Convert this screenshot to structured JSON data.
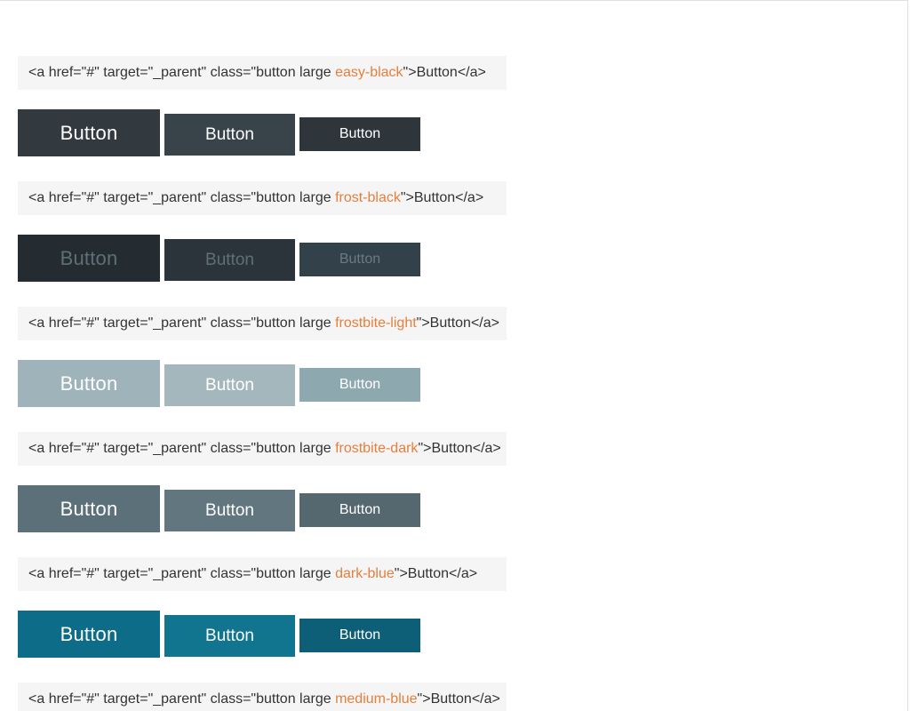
{
  "button_label": "Button",
  "code": {
    "prefix": "<a href=\"#\" target=\"_parent\" class=\"button large ",
    "suffix": "\">Button</a>"
  },
  "sections": [
    {
      "class_name": "easy-black"
    },
    {
      "class_name": "frost-black"
    },
    {
      "class_name": "frostbite-light"
    },
    {
      "class_name": "frostbite-dark"
    },
    {
      "class_name": "dark-blue"
    },
    {
      "class_name": "medium-blue"
    }
  ]
}
